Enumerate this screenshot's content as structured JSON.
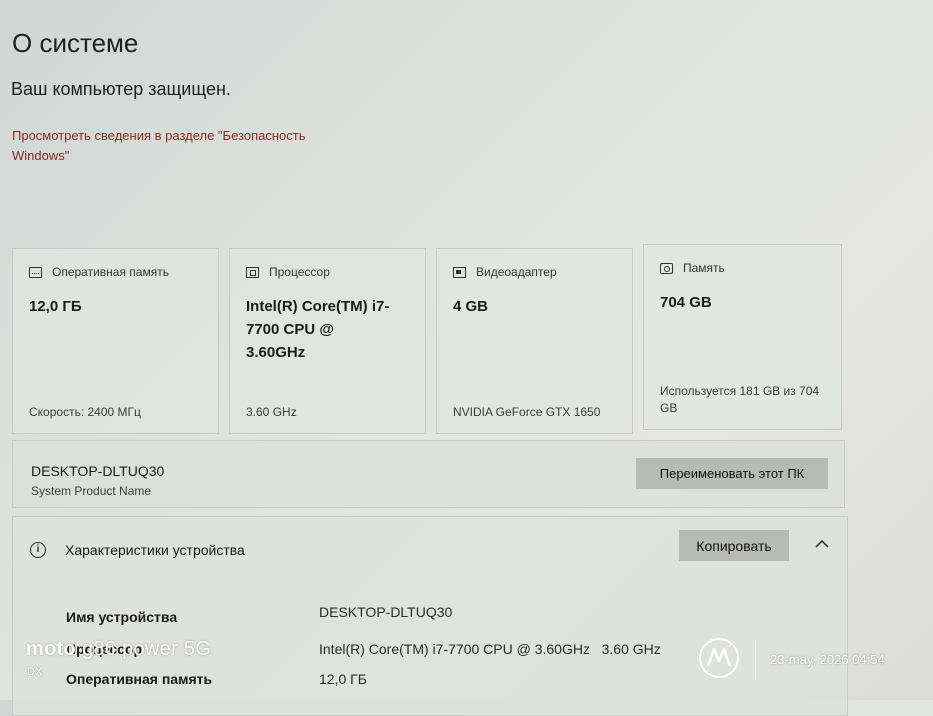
{
  "page": {
    "title": "О системе",
    "protection_status": "Ваш компьютер защищен.",
    "security_link": "Просмотреть сведения в разделе \"Безопасность Windows\""
  },
  "cards": [
    {
      "icon": "ram-icon",
      "header": "Оперативная память",
      "value": "12,0 ГБ",
      "sub": "Скорость: 2400 МГц"
    },
    {
      "icon": "cpu-icon",
      "header": "Процессор",
      "value": "Intel(R) Core(TM) i7-7700 CPU @ 3.60GHz",
      "sub": "3.60 GHz"
    },
    {
      "icon": "gpu-icon",
      "header": "Видеоадаптер",
      "value": "4 GB",
      "sub": "NVIDIA GeForce GTX 1650"
    },
    {
      "icon": "storage-icon",
      "header": "Память",
      "value": "704 GB",
      "sub": "Используется 181 GB из 704 GB"
    }
  ],
  "device": {
    "name": "DESKTOP-DLTUQ30",
    "model": "System Product Name",
    "rename_label": "Переименовать этот ПК"
  },
  "specs": {
    "info_glyph": "i",
    "title": "Характеристики устройства",
    "copy_label": "Копировать",
    "rows": [
      {
        "label": "Имя устройства",
        "value": "DESKTOP-DLTUQ30"
      },
      {
        "label": "Процессор",
        "value": "Intel(R) Core(TM) i7-7700 CPU @ 3.60GHz   3.60 GHz"
      },
      {
        "label": "Оперативная память",
        "value": "12,0 ГБ"
      }
    ]
  },
  "watermark": {
    "brand": "moto",
    "model": "g86 power 5G",
    "dx": "DX",
    "datetime": "23-may, 2026 04:54"
  }
}
